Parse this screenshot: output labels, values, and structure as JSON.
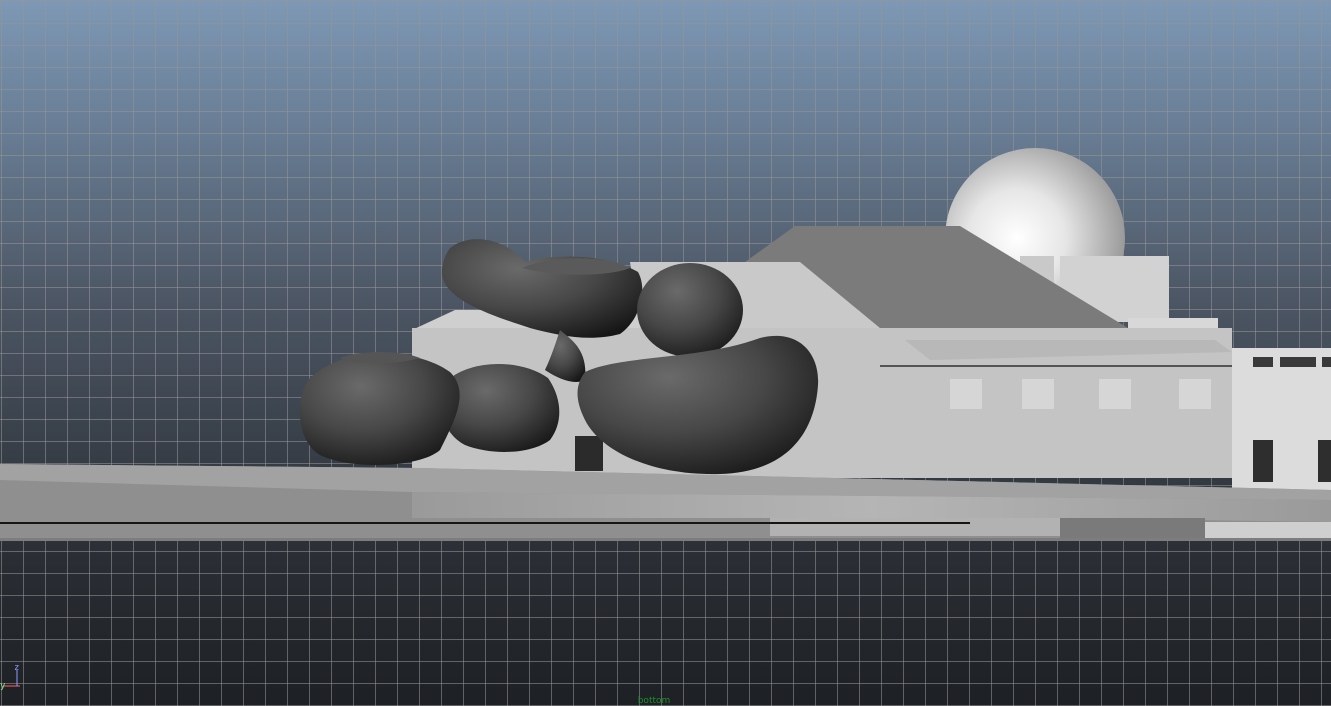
{
  "viewport": {
    "background_top": "#7e98b5",
    "background_bottom": "#1d2024",
    "grid_color": "#969696",
    "object_color": "#4a4a4a",
    "building_color": "#c4c4c4"
  },
  "axis_gizmo": {
    "y_label": "y",
    "z_label": "z",
    "y_color": "#8fe08f",
    "z_color": "#8c9bff",
    "x_color": "#ff6060"
  },
  "view_label": "bottom"
}
